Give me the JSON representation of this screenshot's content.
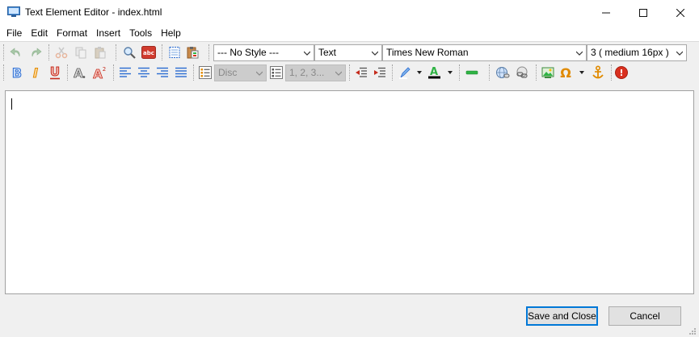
{
  "window": {
    "title": "Text Element Editor - index.html",
    "controls": {
      "minimize": "—",
      "maximize": "☐",
      "close": "✕"
    }
  },
  "menu": {
    "items": [
      {
        "label": "File"
      },
      {
        "label": "Edit"
      },
      {
        "label": "Format"
      },
      {
        "label": "Insert"
      },
      {
        "label": "Tools"
      },
      {
        "label": "Help"
      }
    ]
  },
  "toolbar": {
    "style_select": "--- No Style ---",
    "block_select": "Text",
    "font_select": "Times New Roman",
    "size_select": "3 ( medium 16px )",
    "bullet_select": "Disc",
    "numbering_select": "1, 2, 3...",
    "bold_glyph": "B",
    "italic_glyph": "I",
    "underline_glyph": "U",
    "font_style_glyph": "A",
    "superscript_glyph": "A",
    "superscript_mark": "2",
    "symbol_glyph": "Ω",
    "help_glyph": "!"
  },
  "colors": {
    "accent": "#0078d7",
    "bold": "#2a6bd1",
    "italic": "#e08a00",
    "underline": "#c42b1c",
    "spell": "#d13b2e",
    "green": "#2fb344",
    "red": "#d9301f"
  },
  "buttons": {
    "save_close": "Save and Close",
    "cancel": "Cancel"
  }
}
